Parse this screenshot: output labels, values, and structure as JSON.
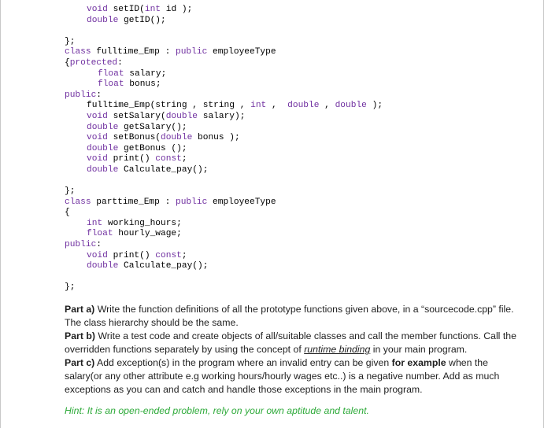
{
  "code_lines": [
    {
      "indent": 2,
      "parts": [
        [
          "kw",
          "void"
        ],
        [
          "fn",
          " setID("
        ],
        [
          "kw",
          "int"
        ],
        [
          "fn",
          " id );"
        ]
      ]
    },
    {
      "indent": 2,
      "parts": [
        [
          "kw",
          "double"
        ],
        [
          "fn",
          " getID();"
        ]
      ]
    },
    {
      "indent": 0,
      "parts": [
        [
          "fn",
          ""
        ]
      ]
    },
    {
      "indent": 0,
      "parts": [
        [
          "fn",
          "};"
        ]
      ]
    },
    {
      "indent": 0,
      "parts": [
        [
          "kw",
          "class"
        ],
        [
          "fn",
          " fulltime_Emp : "
        ],
        [
          "kw",
          "public"
        ],
        [
          "fn",
          " employeeType"
        ]
      ]
    },
    {
      "indent": 0,
      "parts": [
        [
          "fn",
          "{"
        ],
        [
          "kw",
          "protected"
        ],
        [
          "fn",
          ":"
        ]
      ]
    },
    {
      "indent": 3,
      "parts": [
        [
          "kw",
          "float"
        ],
        [
          "fn",
          " salary;"
        ]
      ]
    },
    {
      "indent": 3,
      "parts": [
        [
          "kw",
          "float"
        ],
        [
          "fn",
          " bonus;"
        ]
      ]
    },
    {
      "indent": 0,
      "parts": [
        [
          "kw",
          "public"
        ],
        [
          "fn",
          ":"
        ]
      ]
    },
    {
      "indent": 2,
      "parts": [
        [
          "fn",
          "fulltime_Emp(string , string , "
        ],
        [
          "kw",
          "int"
        ],
        [
          "fn",
          " ,  "
        ],
        [
          "kw",
          "double"
        ],
        [
          "fn",
          " , "
        ],
        [
          "kw",
          "double"
        ],
        [
          "fn",
          " );"
        ]
      ]
    },
    {
      "indent": 2,
      "parts": [
        [
          "kw",
          "void"
        ],
        [
          "fn",
          " setSalary("
        ],
        [
          "kw",
          "double"
        ],
        [
          "fn",
          " salary);"
        ]
      ]
    },
    {
      "indent": 2,
      "parts": [
        [
          "kw",
          "double"
        ],
        [
          "fn",
          " getSalary();"
        ]
      ]
    },
    {
      "indent": 2,
      "parts": [
        [
          "kw",
          "void"
        ],
        [
          "fn",
          " setBonus("
        ],
        [
          "kw",
          "double"
        ],
        [
          "fn",
          " bonus );"
        ]
      ]
    },
    {
      "indent": 2,
      "parts": [
        [
          "kw",
          "double"
        ],
        [
          "fn",
          " getBonus ();"
        ]
      ]
    },
    {
      "indent": 2,
      "parts": [
        [
          "kw",
          "void"
        ],
        [
          "fn",
          " print() "
        ],
        [
          "kw",
          "const"
        ],
        [
          "fn",
          ";"
        ]
      ]
    },
    {
      "indent": 2,
      "parts": [
        [
          "kw",
          "double"
        ],
        [
          "fn",
          " Calculate_pay();"
        ]
      ]
    },
    {
      "indent": 0,
      "parts": [
        [
          "fn",
          ""
        ]
      ]
    },
    {
      "indent": 0,
      "parts": [
        [
          "fn",
          "};"
        ]
      ]
    },
    {
      "indent": 0,
      "parts": [
        [
          "kw",
          "class"
        ],
        [
          "fn",
          " parttime_Emp : "
        ],
        [
          "kw",
          "public"
        ],
        [
          "fn",
          " employeeType"
        ]
      ]
    },
    {
      "indent": 0,
      "parts": [
        [
          "fn",
          "{"
        ]
      ]
    },
    {
      "indent": 2,
      "parts": [
        [
          "kw",
          "int"
        ],
        [
          "fn",
          " working_hours;"
        ]
      ]
    },
    {
      "indent": 2,
      "parts": [
        [
          "kw",
          "float"
        ],
        [
          "fn",
          " hourly_wage;"
        ]
      ]
    },
    {
      "indent": 0,
      "parts": [
        [
          "kw",
          "public"
        ],
        [
          "fn",
          ":"
        ]
      ]
    },
    {
      "indent": 2,
      "parts": [
        [
          "kw",
          "void"
        ],
        [
          "fn",
          " print() "
        ],
        [
          "kw",
          "const"
        ],
        [
          "fn",
          ";"
        ]
      ]
    },
    {
      "indent": 2,
      "parts": [
        [
          "kw",
          "double"
        ],
        [
          "fn",
          " Calculate_pay();"
        ]
      ]
    },
    {
      "indent": 0,
      "parts": [
        [
          "fn",
          ""
        ]
      ]
    },
    {
      "indent": 0,
      "parts": [
        [
          "fn",
          "};"
        ]
      ]
    }
  ],
  "parts": {
    "a_label": "Part a)",
    "a_text": " Write the function definitions of all the prototype functions given above, in a “sourcecode.cpp” file. The class hierarchy should be the same.",
    "b_label": "Part b)",
    "b_text1": " Write a test code and create objects of all/suitable classes and call the member functions. Call the overridden functions separately by using the concept of ",
    "b_emph": "runtime binding",
    "b_text2": " in your main program.",
    "c_label": "Part c)",
    "c_text1": " Add exception(s) in the program where an invalid entry can be given ",
    "c_bold": "for example",
    "c_text2": " when the salary(or any other attribute e.g working hours/hourly wages etc..) is a negative number. Add as much exceptions as you can and catch and handle those exceptions in the main program."
  },
  "hint": "Hint: It is an open-ended problem, rely on your own aptitude and talent."
}
